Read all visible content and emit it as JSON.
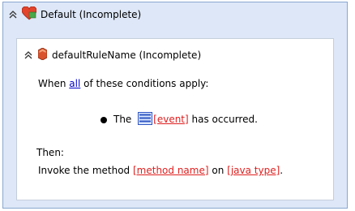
{
  "rule_set": {
    "title": "Default (Incomplete)",
    "icons": {
      "collapse": "double-chevron-up-icon",
      "heart": "heart-icon"
    }
  },
  "rule": {
    "title": "defaultRuleName (Incomplete)",
    "icons": {
      "collapse": "double-chevron-up-icon",
      "shield": "hexagon-shield-icon"
    },
    "when_prefix": "When",
    "when_link": "all",
    "when_suffix": "of these conditions apply:",
    "condition": {
      "prefix": "The",
      "event_link": "[event]",
      "suffix": "has occurred."
    },
    "then_label": "Then:",
    "action": {
      "prefix": "Invoke the method",
      "method_link": "[method name]",
      "middle": "on",
      "type_link": "[java type]",
      "suffix": "."
    }
  },
  "colors": {
    "outer_bg": "#dde7f7",
    "blue_link": "#0000cc",
    "red_link": "#e02020"
  }
}
